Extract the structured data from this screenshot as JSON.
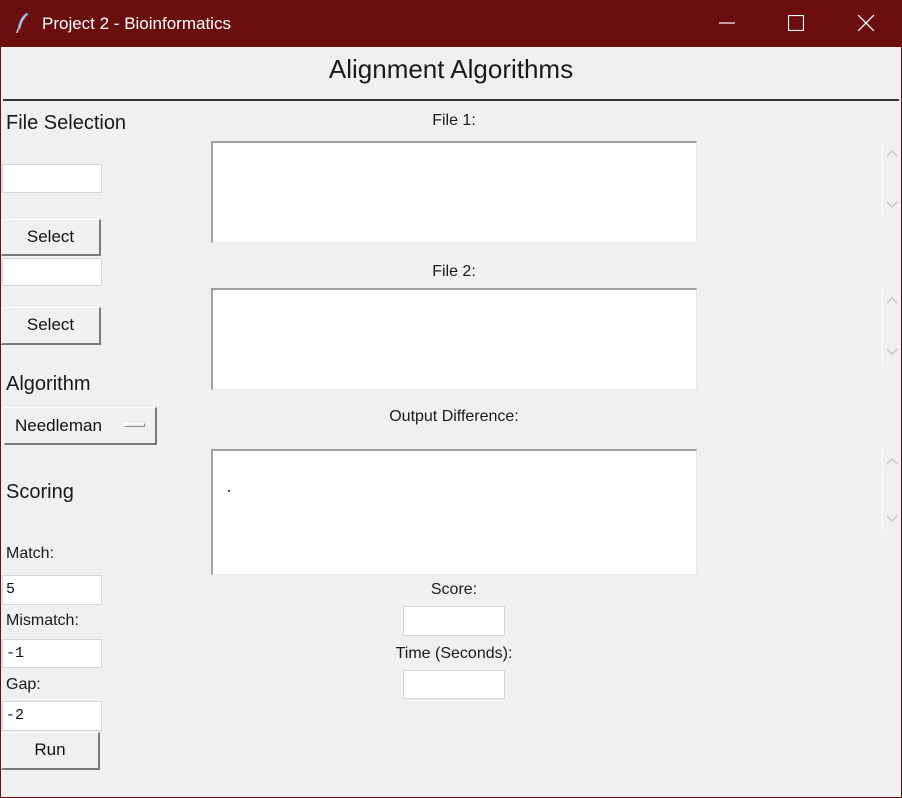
{
  "window": {
    "title": "Project 2 - Bioinformatics",
    "accent_color": "#6b0e0e",
    "controls": [
      "minimize-icon",
      "maximize-icon",
      "close-icon"
    ]
  },
  "header": {
    "title": "Alignment Algorithms"
  },
  "file_selection": {
    "heading": "File Selection",
    "file1_path": "",
    "file1_select_label": "Select",
    "file2_path": "",
    "file2_select_label": "Select"
  },
  "algorithm": {
    "heading": "Algorithm",
    "selected": "Needleman"
  },
  "scoring": {
    "heading": "Scoring",
    "match_label": "Match:",
    "match_value": "5",
    "mismatch_label": "Mismatch:",
    "mismatch_value": "-1",
    "gap_label": "Gap:",
    "gap_value": "-2",
    "run_label": "Run"
  },
  "main": {
    "file1_label": "File 1:",
    "file1_content": "",
    "file2_label": "File 2:",
    "file2_content": "",
    "output_label": "Output Difference:",
    "output_content": "",
    "score_label": "Score:",
    "score_value": "",
    "time_label": "Time (Seconds):",
    "time_value": ""
  }
}
